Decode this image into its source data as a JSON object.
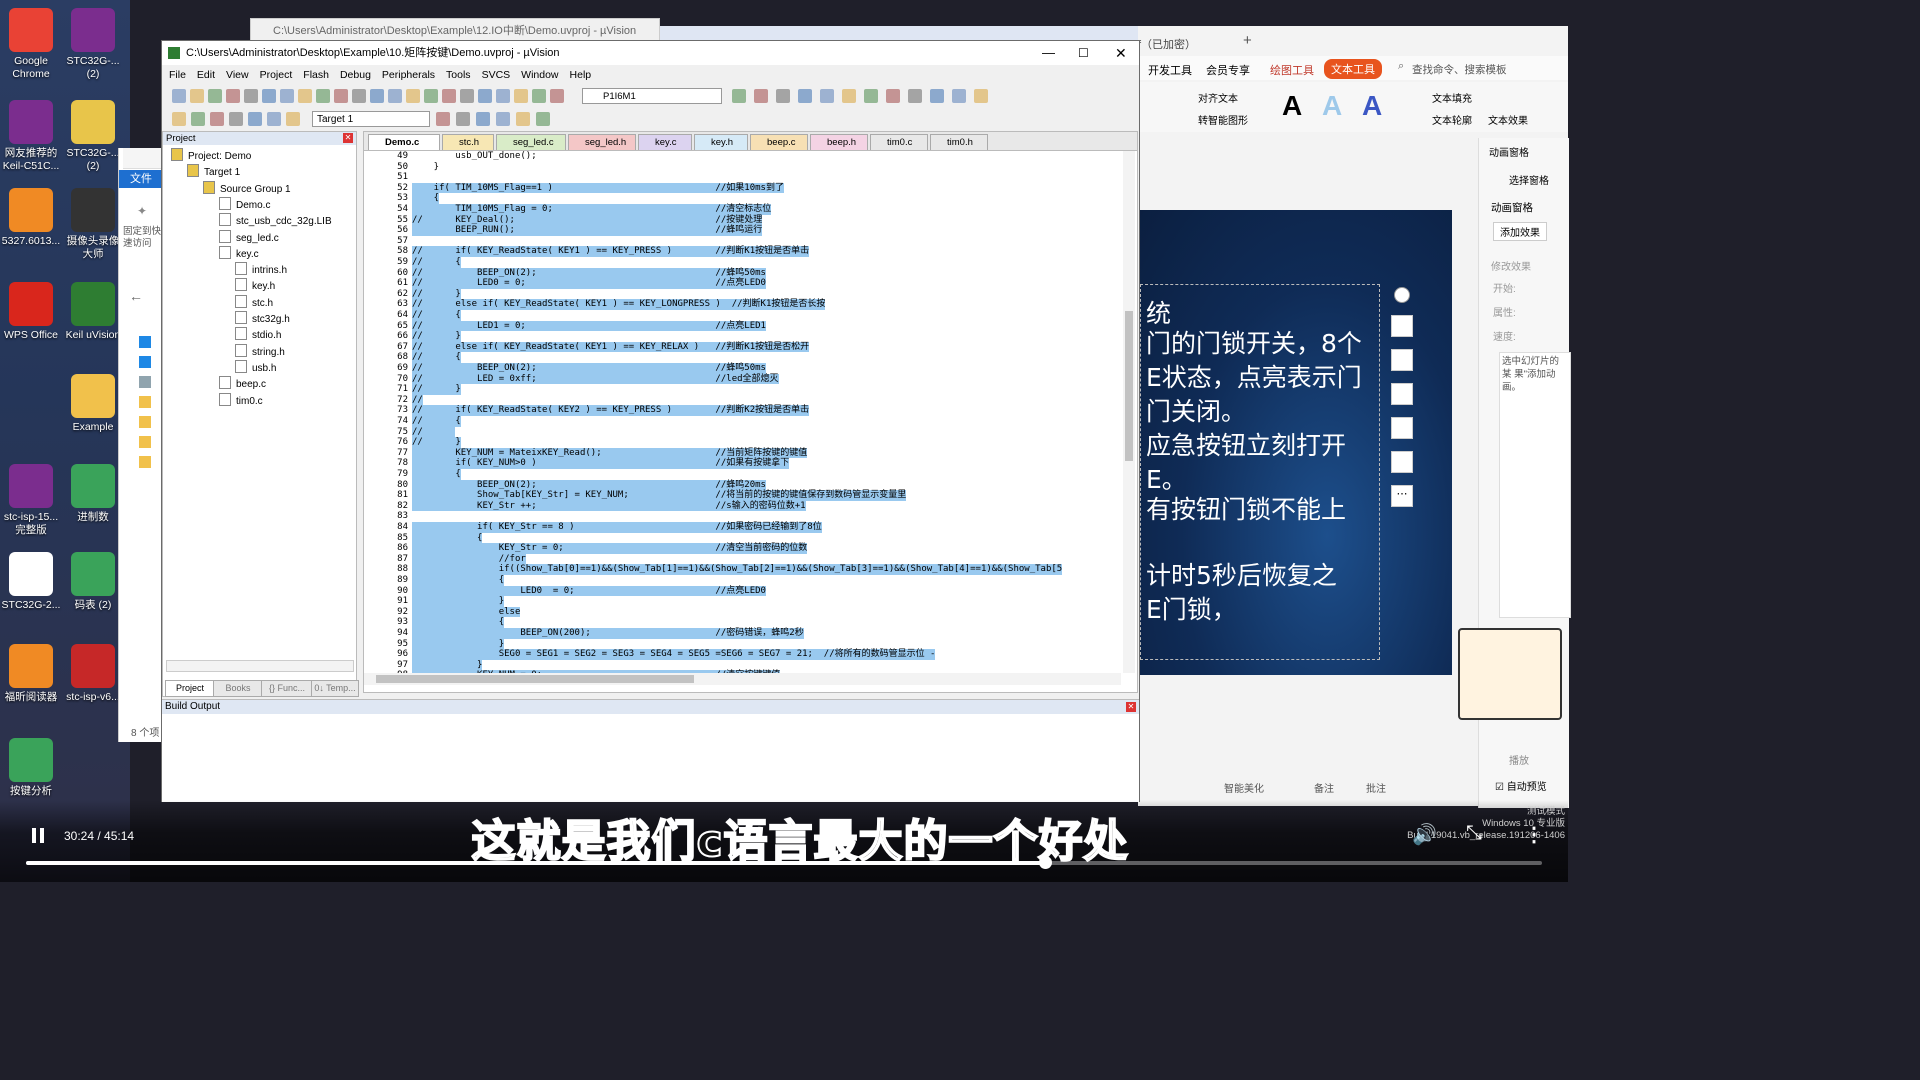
{
  "desktop_icons": [
    {
      "label": "Google Chrome",
      "icon": "chrome-icon",
      "color": "#e94235"
    },
    {
      "label": "STC32G-...(2)",
      "icon": "winrar-icon",
      "color": "#7b2d8e"
    },
    {
      "label": "网友推荐的 Keil-C51C...",
      "icon": "winrar-icon",
      "color": "#7b2d8e"
    },
    {
      "label": "STC32G-...(2)",
      "icon": "folder-doc-icon",
      "color": "#e8c54a"
    },
    {
      "label": "5327.6013...",
      "icon": "pdf-icon",
      "color": "#f08a24"
    },
    {
      "label": "摄像头录像大师",
      "icon": "camera-icon",
      "color": "#333333"
    },
    {
      "label": "WPS Office",
      "icon": "wps-icon",
      "color": "#d9261c"
    },
    {
      "label": "Keil uVision",
      "icon": "keil-icon",
      "color": "#2e7d32"
    },
    {
      "label": "Example",
      "icon": "folder-icon",
      "color": "#f1c14b"
    },
    {
      "label": "stc-isp-15... 完整版",
      "icon": "winrar-icon",
      "color": "#7b2d8e"
    },
    {
      "label": "进制数",
      "icon": "sheet-icon",
      "color": "#3aa35a"
    },
    {
      "label": "STC32G-2...",
      "icon": "doc-icon",
      "color": "#ffffff"
    },
    {
      "label": "码表 (2)",
      "icon": "sheet-icon",
      "color": "#3aa35a"
    },
    {
      "label": "福昕阅读器",
      "icon": "foxit-icon",
      "color": "#f08a24"
    },
    {
      "label": "stc-isp-v6...",
      "icon": "stcisp-icon",
      "color": "#c62828"
    },
    {
      "label": "按键分析",
      "icon": "sheet-icon",
      "color": "#3aa35a"
    }
  ],
  "bg_window_title": "C:\\Users\\Administrator\\Desktop\\Example\\12.IO中断\\Demo.uvproj - µVision",
  "explorer": {
    "file_tab": "文件",
    "pin_label": "固定到快速访问",
    "count": "8 个项"
  },
  "uvision": {
    "title": "C:\\Users\\Administrator\\Desktop\\Example\\10.矩阵按键\\Demo.uvproj - µVision",
    "menu": [
      "File",
      "Edit",
      "View",
      "Project",
      "Flash",
      "Debug",
      "Peripherals",
      "Tools",
      "SVCS",
      "Window",
      "Help"
    ],
    "toolbar_combo": "P1I6M1",
    "target_combo": "Target 1",
    "project_panel_title": "Project",
    "tree": [
      {
        "label": "Project: Demo",
        "indent": 0
      },
      {
        "label": "Target 1",
        "indent": 1
      },
      {
        "label": "Source Group 1",
        "indent": 2
      },
      {
        "label": "Demo.c",
        "indent": 3
      },
      {
        "label": "stc_usb_cdc_32g.LIB",
        "indent": 3
      },
      {
        "label": "seg_led.c",
        "indent": 3
      },
      {
        "label": "key.c",
        "indent": 3
      },
      {
        "label": "intrins.h",
        "indent": 4
      },
      {
        "label": "key.h",
        "indent": 4
      },
      {
        "label": "stc.h",
        "indent": 4
      },
      {
        "label": "stc32g.h",
        "indent": 4
      },
      {
        "label": "stdio.h",
        "indent": 4
      },
      {
        "label": "string.h",
        "indent": 4
      },
      {
        "label": "usb.h",
        "indent": 4
      },
      {
        "label": "beep.c",
        "indent": 3
      },
      {
        "label": "tim0.c",
        "indent": 3
      }
    ],
    "panel_tabs": [
      "Project",
      "Books",
      "{} Func...",
      "0↓ Temp..."
    ],
    "editor_tabs": [
      {
        "label": "Demo.c",
        "color": "#ffffff"
      },
      {
        "label": "stc.h",
        "color": "#f7e7b4"
      },
      {
        "label": "seg_led.c",
        "color": "#d9ecc8"
      },
      {
        "label": "seg_led.h",
        "color": "#f4c7c7"
      },
      {
        "label": "key.c",
        "color": "#dcd3f0"
      },
      {
        "label": "key.h",
        "color": "#d6eaf7"
      },
      {
        "label": "beep.c",
        "color": "#f7e0b4"
      },
      {
        "label": "beep.h",
        "color": "#f4d3e4"
      },
      {
        "label": "tim0.c",
        "color": "#e8e8e8"
      },
      {
        "label": "tim0.h",
        "color": "#e8e8e8"
      }
    ],
    "build_output_title": "Build Output",
    "code_lines": [
      {
        "n": "49",
        "t": "        usb_OUT_done();",
        "sel": false
      },
      {
        "n": "50",
        "t": "    }",
        "sel": false
      },
      {
        "n": "51",
        "t": "",
        "sel": false
      },
      {
        "n": "52",
        "t": "    if( TIM_10MS_Flag==1 )                              //如果10ms到了",
        "sel": true
      },
      {
        "n": "53",
        "t": "    {",
        "sel": true
      },
      {
        "n": "54",
        "t": "        TIM_10MS_Flag = 0;                              //清空标志位",
        "sel": true
      },
      {
        "n": "55",
        "t": "//      KEY_Deal();                                     //按键处理",
        "sel": true
      },
      {
        "n": "56",
        "t": "        BEEP_RUN();                                     //蜂鸣运行",
        "sel": true
      },
      {
        "n": "57",
        "t": "",
        "sel": true
      },
      {
        "n": "58",
        "t": "//      if( KEY_ReadState( KEY1 ) == KEY_PRESS )        //判断K1按钮是否单击",
        "sel": true
      },
      {
        "n": "59",
        "t": "//      {",
        "sel": true
      },
      {
        "n": "60",
        "t": "//          BEEP_ON(2);                                 //蜂鸣50ms",
        "sel": true
      },
      {
        "n": "61",
        "t": "//          LED0 = 0;                                   //点亮LED0",
        "sel": true
      },
      {
        "n": "62",
        "t": "//      }",
        "sel": true
      },
      {
        "n": "63",
        "t": "//      else if( KEY_ReadState( KEY1 ) == KEY_LONGPRESS )  //判断K1按钮是否长按",
        "sel": true
      },
      {
        "n": "64",
        "t": "//      {",
        "sel": true
      },
      {
        "n": "65",
        "t": "//          LED1 = 0;                                   //点亮LED1",
        "sel": true
      },
      {
        "n": "66",
        "t": "//      }",
        "sel": true
      },
      {
        "n": "67",
        "t": "//      else if( KEY_ReadState( KEY1 ) == KEY_RELAX )   //判断K1按钮是否松开",
        "sel": true
      },
      {
        "n": "68",
        "t": "//      {",
        "sel": true
      },
      {
        "n": "69",
        "t": "//          BEEP_ON(2);                                 //蜂鸣50ms",
        "sel": true
      },
      {
        "n": "70",
        "t": "//          LED = 0xff;                                 //led全部熄灭",
        "sel": true
      },
      {
        "n": "71",
        "t": "//      }",
        "sel": true
      },
      {
        "n": "72",
        "t": "//",
        "sel": true
      },
      {
        "n": "73",
        "t": "//      if( KEY_ReadState( KEY2 ) == KEY_PRESS )        //判断K2按钮是否单击",
        "sel": true
      },
      {
        "n": "74",
        "t": "//      {",
        "sel": true
      },
      {
        "n": "75",
        "t": "//      ",
        "sel": true
      },
      {
        "n": "76",
        "t": "//      }",
        "sel": true
      },
      {
        "n": "77",
        "t": "        KEY_NUM = MateixKEY_Read();                     //当前矩阵按键的键值",
        "sel": true
      },
      {
        "n": "78",
        "t": "        if( KEY_NUM>0 )                                 //如果有按键拿下",
        "sel": true
      },
      {
        "n": "79",
        "t": "        {",
        "sel": true
      },
      {
        "n": "80",
        "t": "            BEEP_ON(2);                                 //蜂鸣20ms",
        "sel": true
      },
      {
        "n": "81",
        "t": "            Show_Tab[KEY_Str] = KEY_NUM;                //将当前的按键的键值保存到数码管显示变量里",
        "sel": true
      },
      {
        "n": "82",
        "t": "            KEY_Str ++;                                 //s输入的密码位数+1",
        "sel": true
      },
      {
        "n": "83",
        "t": "",
        "sel": true
      },
      {
        "n": "84",
        "t": "            if( KEY_Str == 8 )                          //如果密码已经输到了8位",
        "sel": true
      },
      {
        "n": "85",
        "t": "            {",
        "sel": true
      },
      {
        "n": "86",
        "t": "                KEY_Str = 0;                            //清空当前密码的位数",
        "sel": true
      },
      {
        "n": "87",
        "t": "                //for",
        "sel": true
      },
      {
        "n": "88",
        "t": "                if((Show_Tab[0]==1)&&(Show_Tab[1]==1)&&(Show_Tab[2]==1)&&(Show_Tab[3]==1)&&(Show_Tab[4]==1)&&(Show_Tab[5",
        "sel": true
      },
      {
        "n": "89",
        "t": "                {",
        "sel": true
      },
      {
        "n": "90",
        "t": "                    LED0  = 0;                          //点亮LED0",
        "sel": true
      },
      {
        "n": "91",
        "t": "                }",
        "sel": true
      },
      {
        "n": "92",
        "t": "                else",
        "sel": true
      },
      {
        "n": "93",
        "t": "                {",
        "sel": true
      },
      {
        "n": "94",
        "t": "                    BEEP_ON(200);                       //密码错误，蜂鸣2秒",
        "sel": true
      },
      {
        "n": "95",
        "t": "                }",
        "sel": true
      },
      {
        "n": "96",
        "t": "                SEG0 = SEG1 = SEG2 = SEG3 = SEG4 = SEG5 =SEG6 = SEG7 = 21;  //将所有的数码管显示位 -",
        "sel": true
      },
      {
        "n": "97",
        "t": "            }",
        "sel": true
      },
      {
        "n": "98",
        "t": "            KEY_NUM = 0;                                //清空按键键值",
        "sel": true
      }
    ]
  },
  "wps": {
    "tab_partial": "f（已加密）",
    "menu": [
      "开发工具",
      "会员专享",
      "绘图工具",
      "文本工具"
    ],
    "search": "查找命令、搜索模板",
    "text_fill": "文本填充",
    "text_outline": "文本轮廓",
    "text_effect": "文本效果",
    "align_text": "对齐文本",
    "convert_shape": "转智能图形",
    "anim_panel": "动画窗格",
    "select_pane": "选择窗格",
    "anim_pane2": "动画窗格",
    "add_effect": "添加效果",
    "modify_effect": "修改效果",
    "start": "开始:",
    "prop": "属性:",
    "speed": "速度:",
    "hint": "选中幻灯片的某 果\"添加动画。",
    "play": "播放",
    "auto_preview": "自动预览",
    "status_items": [
      "智能美化",
      "备注",
      "批注"
    ],
    "slide_lines": [
      "统",
      "门的门锁开关，8个",
      "E状态，点亮表示门",
      "门关闭。",
      "应急按钮立刻打开",
      "E。",
      "有按钮门锁不能上",
      "计时5秒后恢复之",
      "E门锁，"
    ],
    "watermark": [
      "测试模式",
      "Windows 10 专业版",
      "Build 19041.vb_release.191206-1406"
    ]
  },
  "video": {
    "subtitle": "这就是我们c语言最大的一个好处",
    "time": "30:24 / 45:14",
    "progress": 0.672
  }
}
